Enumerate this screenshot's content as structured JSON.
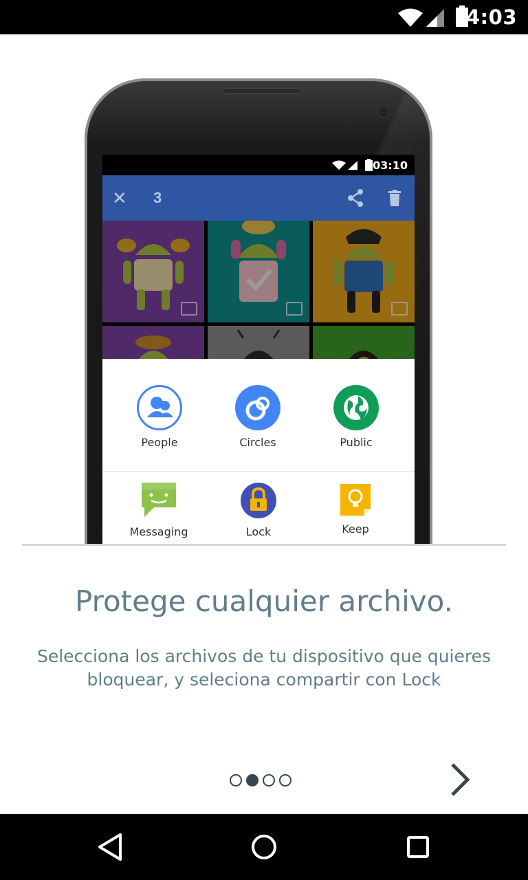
{
  "status_bar": {
    "time": "4:03",
    "icons": [
      "wifi-icon",
      "cell-signal-icon",
      "battery-icon"
    ]
  },
  "illustration": {
    "inner_status_time": "03:10",
    "appbar": {
      "close_icon": "close-icon",
      "selected_count": "3",
      "actions": [
        "share-icon",
        "delete-icon"
      ]
    },
    "share_targets": [
      {
        "label": "People",
        "icon": "people-icon"
      },
      {
        "label": "Circles",
        "icon": "circles-icon"
      },
      {
        "label": "Public",
        "icon": "globe-icon"
      },
      {
        "label": "Messaging",
        "icon": "messaging-icon"
      },
      {
        "label": "Lock",
        "icon": "lock-icon"
      },
      {
        "label": "Keep",
        "icon": "keep-icon"
      }
    ]
  },
  "onboarding": {
    "title": "Protege cualquier archivo.",
    "description": "Selecciona los archivos de tu dispositivo que quieres bloquear, y seleciona compartir con Lock",
    "page_index": 2,
    "page_count": 4,
    "next_icon": "chevron-right-icon"
  },
  "nav_bar": {
    "buttons": [
      "back-icon",
      "home-icon",
      "recents-icon"
    ]
  },
  "colors": {
    "text": "#607d8b",
    "dot": "#37474f",
    "appbar": "#2f56a3",
    "people": "#4285f4",
    "public": "#0f9d58",
    "messaging": "#8bc34a",
    "lock": "#3f51b5",
    "keep": "#f4b400"
  }
}
